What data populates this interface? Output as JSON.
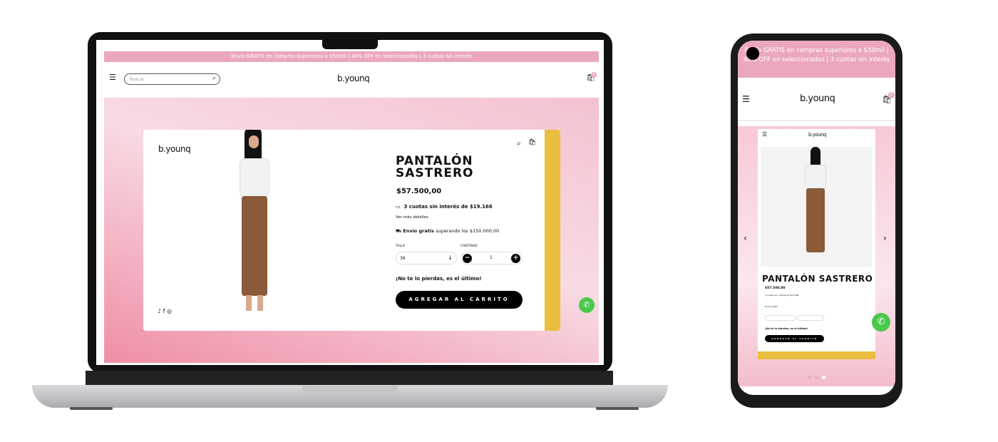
{
  "site": {
    "promo": "Envío GRATIS en compras superiores a $50mil | 40% OFF en seleccionados | 3 cuotas sin interés",
    "logo": "b.younq",
    "cart_count": "0",
    "search_placeholder": "Buscar"
  },
  "product": {
    "name": "PANTALÓN SASTRERO",
    "price": "$57.500,00",
    "installments": "3 cuotas sin interés de $19.166",
    "details_link": "Ver más detalles",
    "shipping_bold": "Envío gratis",
    "shipping_text": "superando los",
    "shipping_amount": "$150.000,00",
    "size_label": "TALLE",
    "size_value": "36",
    "qty_label": "CANTIDAD",
    "qty_value": "1",
    "urgency": "¡No te lo pierdas, es el último!",
    "add_to_cart": "AGREGAR AL CARRITO"
  },
  "phone": {
    "promo": "Envío GRATIS en compras superiores a $50mil | 40% OFF en seleccionados | 3 cuotas sin interés",
    "product_name": "PANTALÓN SASTRERO",
    "carousel_dots": 3,
    "active_dot": 3
  },
  "colors": {
    "promo": "#eba8bd",
    "accent_yellow": "#ebbe3f",
    "whatsapp": "#4ac84a"
  }
}
